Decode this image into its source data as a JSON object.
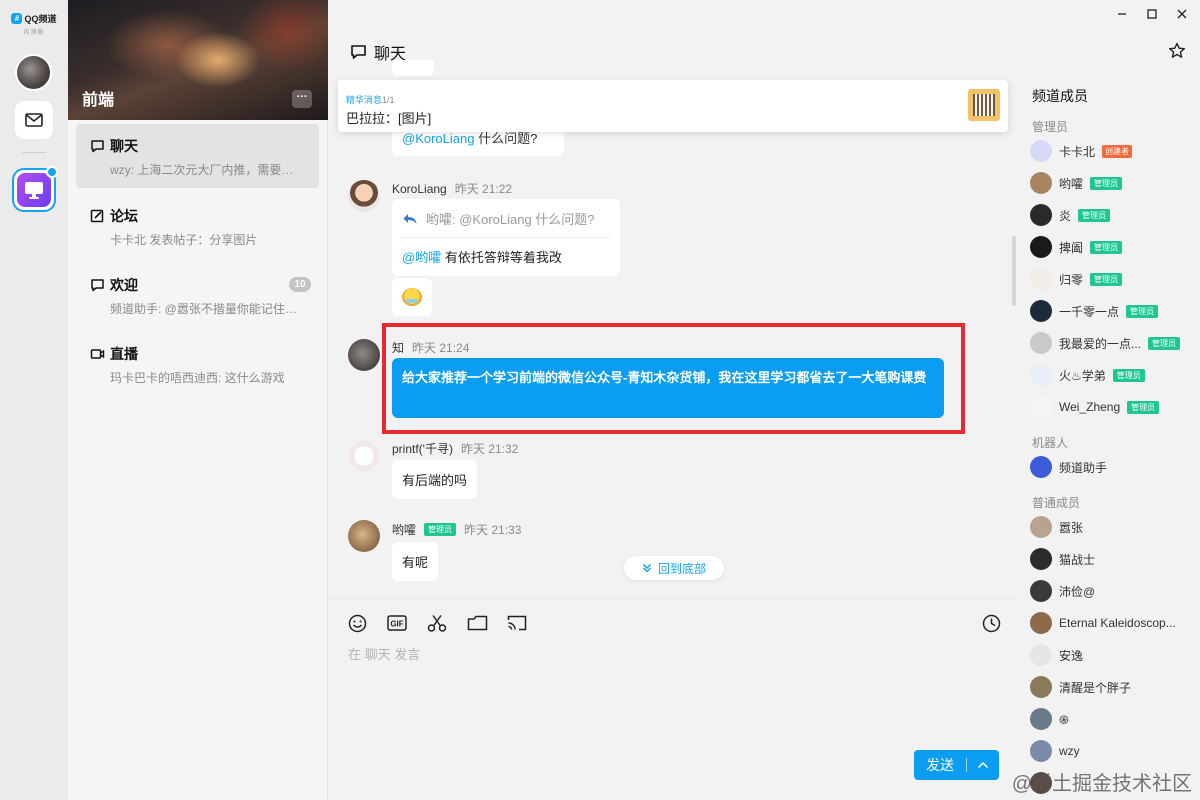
{
  "app": {
    "logo_text": "QQ频道",
    "logo_sub": "内测版"
  },
  "guild": {
    "name": "前端",
    "more_label": "···"
  },
  "channels": [
    {
      "name": "聊天",
      "preview": "wzy: 上海二次元大厂内推，需要私我",
      "icon": "chat-bubble-icon",
      "active": true
    },
    {
      "name": "论坛",
      "preview": "卡卡北 发表帖子：分享图片",
      "icon": "edit-icon"
    },
    {
      "name": "欢迎",
      "preview": "频道助手: @嚣张不揩量你能记住这...",
      "icon": "chat-bubble-icon",
      "badge": "10"
    },
    {
      "name": "直播",
      "preview": "玛卡巴卡的唔西迪西: 这什么游戏",
      "icon": "video-icon"
    }
  ],
  "chat": {
    "title": "聊天",
    "pinned": {
      "label": "精华消息",
      "count": "1/1",
      "text": "巴拉拉：[图片]"
    },
    "prev_message": {
      "at": "@KoroLiang",
      "text": " 什么问题?"
    },
    "messages": [
      {
        "sender": "KoroLiang",
        "time": "昨天 21:22",
        "quote": "哟嚯: @KoroLiang 什么问题?",
        "at": "@哟嚯",
        "text": " 有依托答辩等着我改"
      },
      {
        "sender": "知",
        "time": "昨天 21:24",
        "text": "给大家推荐一个学习前端的微信公众号-青知木杂货铺，我在这里学习都省去了一大笔购课费"
      },
      {
        "sender": "printf('千寻)",
        "time": "昨天 21:32",
        "text": "有后端的吗"
      },
      {
        "sender": "哟嚯",
        "tag": "管理员",
        "time": "昨天 21:33",
        "text": "有呢"
      }
    ],
    "back_to_bottom": "回到底部",
    "input_placeholder": "在 聊天 发言",
    "send_label": "发送"
  },
  "members": {
    "title": "频道成员",
    "sections": {
      "admins": "管理员",
      "robots": "机器人",
      "normal": "普通成员"
    },
    "admin_list": [
      {
        "name": "卡卡北",
        "tag": "创建者",
        "color": "#d6d9f5"
      },
      {
        "name": "哟嚯",
        "tag": "管理员",
        "color": "#a88460"
      },
      {
        "name": "炎",
        "tag": "管理员",
        "color": "#2a2a2a"
      },
      {
        "name": "捭阖",
        "tag": "管理员",
        "color": "#1a1a1a"
      },
      {
        "name": "归零",
        "tag": "管理员",
        "color": "#f1ece6"
      },
      {
        "name": "一千零一点",
        "tag": "管理员",
        "color": "#1d2a3a"
      },
      {
        "name": "我最爱的一点...",
        "tag": "管理员",
        "color": "#c9c9c9"
      },
      {
        "name": "火♨学弟",
        "tag": "管理员",
        "color": "#e7eef5"
      },
      {
        "name": "Wei_Zheng",
        "tag": "管理员",
        "color": "#f5f5f5"
      }
    ],
    "robot_list": [
      {
        "name": "频道助手",
        "color": "#3c5bd6"
      }
    ],
    "normal_list": [
      {
        "name": "嚣张",
        "color": "#b8a48e"
      },
      {
        "name": "猫战士",
        "color": "#2b2b2b"
      },
      {
        "name": "沛俭@",
        "color": "#3a3a3a"
      },
      {
        "name": "Eternal Kaleidoscop...",
        "color": "#8c6a4a"
      },
      {
        "name": "安逸",
        "color": "#e6e6e6"
      },
      {
        "name": "清醒是个胖子",
        "color": "#8a7a5a"
      },
      {
        "name": "֍",
        "color": "#6b7a8a"
      },
      {
        "name": "wzy",
        "color": "#7a8aa8"
      },
      {
        "name": "",
        "color": "#5a4a40"
      }
    ]
  },
  "watermark": "@稀土掘金技术社区"
}
